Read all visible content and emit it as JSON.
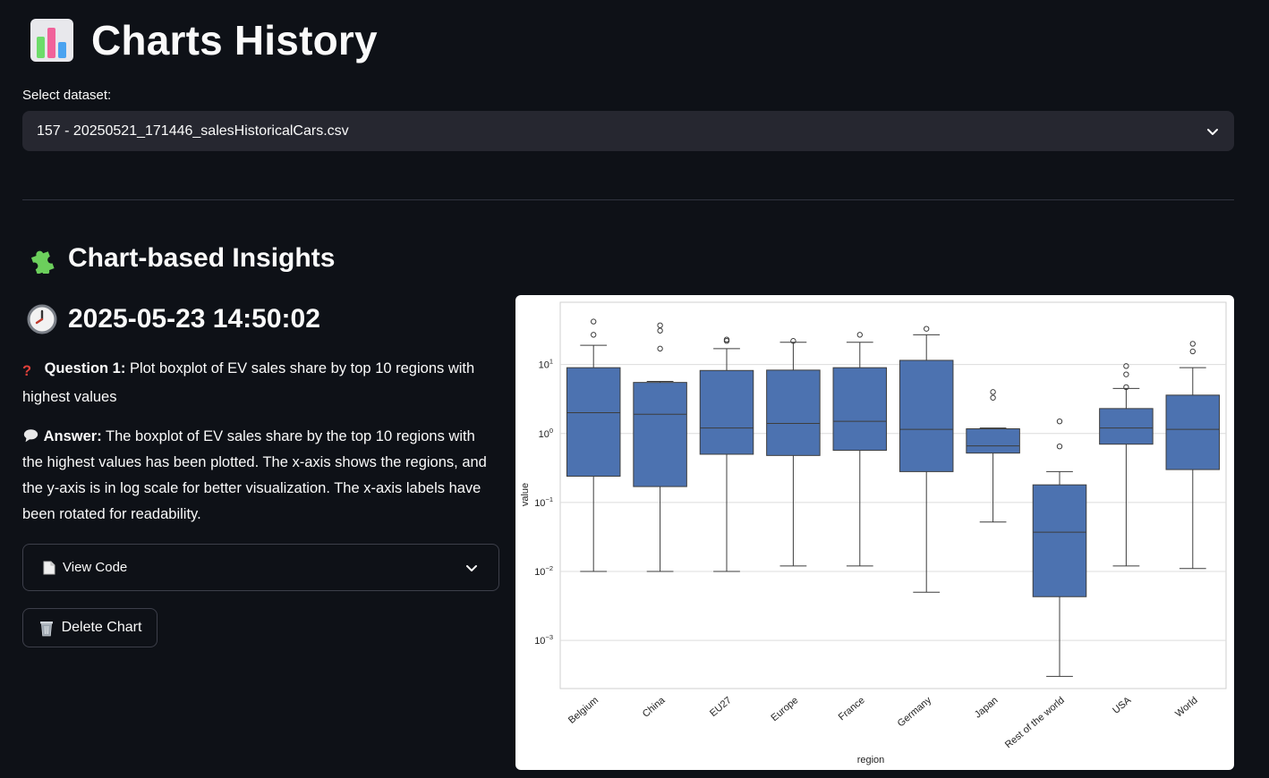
{
  "page": {
    "title": "Charts History",
    "title_icon": "bar-chart-icon"
  },
  "dataset": {
    "label": "Select dataset:",
    "selected": "157 - 20250521_171446_salesHistoricalCars.csv"
  },
  "insights": {
    "heading": "Chart-based Insights",
    "timestamp": "2025-05-23 14:50:02",
    "question_label": "Question 1:",
    "question_text": "Plot boxplot of EV sales share by top 10 regions with highest values",
    "answer_label": "Answer:",
    "answer_text": "The boxplot of EV sales share by the top 10 regions with the highest values has been plotted. The x-axis shows the regions, and the y-axis is in log scale for better visualization. The x-axis labels have been rotated for readability.",
    "view_code_label": "View Code",
    "delete_label": "Delete Chart"
  },
  "colors": {
    "background": "#0e1117",
    "select_bg": "#262730",
    "box_fill": "#4c72b0"
  },
  "chart_data": {
    "type": "boxplot",
    "xlabel": "region",
    "ylabel": "value",
    "yscale": "log",
    "ylim": [
      0.0002,
      80
    ],
    "yticks": [
      {
        "exp": "1"
      },
      {
        "exp": "0"
      },
      {
        "exp": "−1"
      },
      {
        "exp": "−2"
      },
      {
        "exp": "−3"
      }
    ],
    "grid": true,
    "categories": [
      "Belgium",
      "China",
      "EU27",
      "Europe",
      "France",
      "Germany",
      "Japan",
      "Rest of the world",
      "USA",
      "World"
    ],
    "boxes": [
      {
        "whislo": 0.01,
        "q1": 0.24,
        "med": 2.0,
        "q3": 9.0,
        "whishi": 19,
        "fliers": [
          27,
          42
        ]
      },
      {
        "whislo": 0.01,
        "q1": 0.17,
        "med": 1.9,
        "q3": 5.5,
        "whishi": 5.7,
        "fliers": [
          17,
          31,
          37
        ]
      },
      {
        "whislo": 0.01,
        "q1": 0.5,
        "med": 1.2,
        "q3": 8.2,
        "whishi": 17,
        "fliers": [
          22,
          23
        ]
      },
      {
        "whislo": 0.012,
        "q1": 0.48,
        "med": 1.4,
        "q3": 8.3,
        "whishi": 21,
        "fliers": [
          22
        ]
      },
      {
        "whislo": 0.012,
        "q1": 0.57,
        "med": 1.5,
        "q3": 9.0,
        "whishi": 21,
        "fliers": [
          27
        ]
      },
      {
        "whislo": 0.005,
        "q1": 0.28,
        "med": 1.15,
        "q3": 11.5,
        "whishi": 27,
        "fliers": [
          33
        ]
      },
      {
        "whislo": 0.052,
        "q1": 0.52,
        "med": 0.66,
        "q3": 1.17,
        "whishi": 1.2,
        "fliers": [
          3.3,
          4.0
        ]
      },
      {
        "whislo": 0.0003,
        "q1": 0.0043,
        "med": 0.037,
        "q3": 0.18,
        "whishi": 0.28,
        "fliers": [
          0.65,
          1.5
        ]
      },
      {
        "whislo": 0.012,
        "q1": 0.7,
        "med": 1.2,
        "q3": 2.3,
        "whishi": 4.5,
        "fliers": [
          4.7,
          7.2,
          9.5
        ]
      },
      {
        "whislo": 0.011,
        "q1": 0.3,
        "med": 1.15,
        "q3": 3.6,
        "whishi": 9.0,
        "fliers": [
          15.5,
          20
        ]
      }
    ]
  }
}
